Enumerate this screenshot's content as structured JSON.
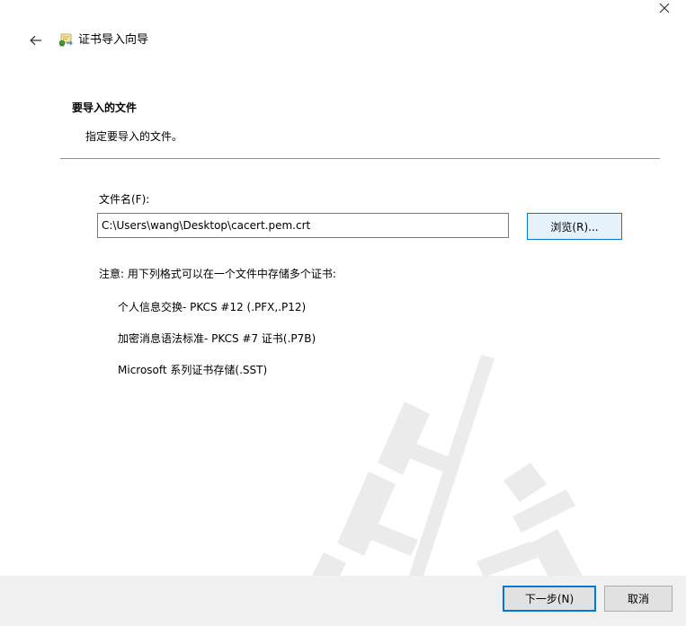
{
  "window": {
    "title": "证书导入向导",
    "close_icon": "close-icon",
    "back_icon": "back-arrow-icon",
    "app_icon": "certificate-wizard-icon"
  },
  "section": {
    "heading": "要导入的文件",
    "description": "指定要导入的文件。"
  },
  "file": {
    "label": "文件名(F):",
    "value": "C:\\Users\\wang\\Desktop\\cacert.pem.crt",
    "browse_label": "浏览(R)..."
  },
  "note": {
    "text": "注意: 用下列格式可以在一个文件中存储多个证书:",
    "formats": [
      "个人信息交换- PKCS #12 (.PFX,.P12)",
      "加密消息语法标准- PKCS #7 证书(.P7B)",
      "Microsoft 系列证书存储(.SST)"
    ]
  },
  "footer": {
    "next_label": "下一步(N)",
    "cancel_label": "取消"
  },
  "colors": {
    "accent": "#0078d7",
    "footer_bg": "#f0f0f0",
    "button_bg": "#e1e1e1"
  }
}
